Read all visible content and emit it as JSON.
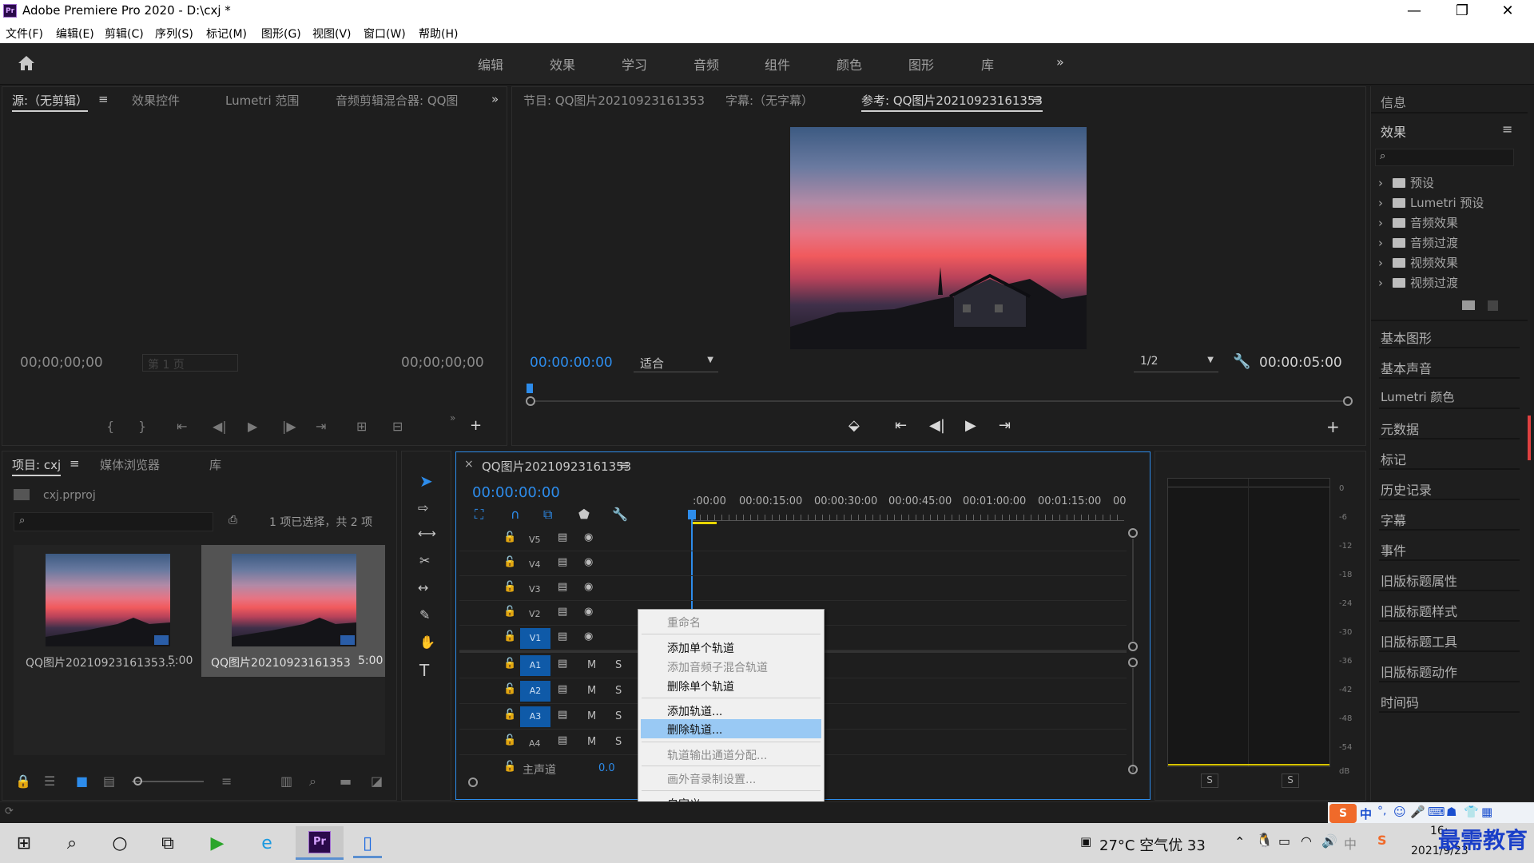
{
  "app": {
    "title": "Adobe Premiere Pro 2020 - D:\\cxj *",
    "logo": "Pr",
    "win_minimize": "—",
    "win_restore": "❐",
    "win_close": "✕"
  },
  "menu": [
    "文件(F)",
    "编辑(E)",
    "剪辑(C)",
    "序列(S)",
    "标记(M)",
    "图形(G)",
    "视图(V)",
    "窗口(W)",
    "帮助(H)"
  ],
  "workspaces": [
    "编辑",
    "效果",
    "学习",
    "音频",
    "组件",
    "颜色",
    "图形",
    "库"
  ],
  "workspaces_more": "»",
  "source_panel": {
    "tabs": [
      "源:（无剪辑）",
      "效果控件",
      "Lumetri 范围",
      "音频剪辑混合器: QQ图"
    ],
    "tab_menu": "≡",
    "more": "»",
    "timecode_left": "00;00;00;00",
    "timecode_right": "00;00;00;00",
    "page_select": "第 1 页"
  },
  "program_panel": {
    "tabs": [
      "节目: QQ图片20210923161353",
      "字幕:（无字幕）",
      "参考: QQ图片20210923161353"
    ],
    "tab_menu": "≡",
    "timecode": "00:00:00:00",
    "fit": "适合",
    "resolution": "1/2",
    "duration": "00:00:05:00",
    "add": "+"
  },
  "project_panel": {
    "tabs": [
      "项目: cxj",
      "媒体浏览器",
      "库"
    ],
    "tab_menu": "≡",
    "project_file": "cxj.prproj",
    "selection_status": "1 项已选择，共 2 项",
    "items": [
      {
        "name": "QQ图片20210923161353...",
        "duration": "5:00"
      },
      {
        "name": "QQ图片20210923161353",
        "duration": "5:00"
      }
    ]
  },
  "timeline": {
    "close": "×",
    "sequence_name": "QQ图片20210923161353",
    "tab_menu": "≡",
    "timecode": "00:00:00:00",
    "ruler": [
      ":00:00",
      "00:00:15:00",
      "00:00:30:00",
      "00:00:45:00",
      "00:01:00:00",
      "00:01:15:00",
      "00"
    ],
    "video_tracks": [
      "V5",
      "V4",
      "V3",
      "V2",
      "V1"
    ],
    "audio_tracks": [
      "A1",
      "A2",
      "A3",
      "A4"
    ],
    "master_label": "主声道",
    "master_value": "0.0",
    "mute": "M",
    "solo": "S"
  },
  "context_menu": {
    "items": [
      {
        "label": "重命名",
        "enabled": false
      },
      {
        "label": "添加单个轨道",
        "enabled": true
      },
      {
        "label": "添加音频子混合轨道",
        "enabled": false
      },
      {
        "label": "删除单个轨道",
        "enabled": true
      },
      {
        "label": "添加轨道...",
        "enabled": true
      },
      {
        "label": "删除轨道...",
        "enabled": true,
        "highlighted": true
      },
      {
        "label": "轨道输出通道分配...",
        "enabled": false
      },
      {
        "label": "画外音录制设置...",
        "enabled": false
      },
      {
        "label": "自定义...",
        "enabled": true
      }
    ]
  },
  "audio_meter": {
    "db_marks": [
      "0",
      "-6",
      "-12",
      "-18",
      "-24",
      "-30",
      "-36",
      "-42",
      "-48",
      "-54",
      "dB"
    ],
    "solo_left": "S",
    "solo_right": "S"
  },
  "right_panel": {
    "info": "信息",
    "effects_title": "效果",
    "effects_menu": "≡",
    "effects_tree": [
      "预设",
      "Lumetri 预设",
      "音频效果",
      "音频过渡",
      "视频效果",
      "视频过渡"
    ],
    "panels": [
      "基本图形",
      "基本声音",
      "Lumetri 颜色",
      "元数据",
      "标记",
      "历史记录",
      "字幕",
      "事件",
      "旧版标题属性",
      "旧版标题样式",
      "旧版标题工具",
      "旧版标题动作",
      "时间码"
    ]
  },
  "taskbar": {
    "weather": "27°C 空气优 33",
    "ime": "中",
    "date": "2021/9/23",
    "time": "16:",
    "watermark": "最需教育"
  }
}
